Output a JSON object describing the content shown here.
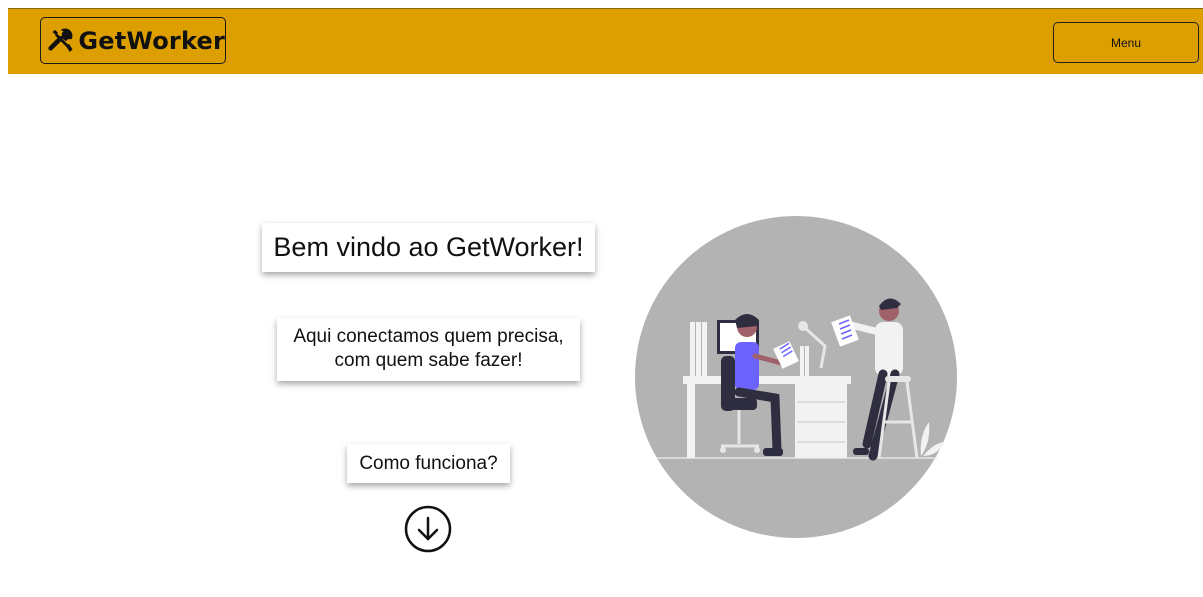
{
  "header": {
    "brand": "GetWorker",
    "brand_icon": "tools-icon",
    "menu_label": "Menu",
    "background_color": "#dd9f00"
  },
  "hero": {
    "title": "Bem vindo ao GetWorker!",
    "tagline_line1": "Aqui conectamos quem precisa,",
    "tagline_line2": "com quem sabe fazer!",
    "how_it_works": "Como funciona?",
    "scroll_icon": "arrow-down-circle-icon",
    "illustration": "office-workers-illustration",
    "illustration_bg_color": "#b3b3b3"
  }
}
